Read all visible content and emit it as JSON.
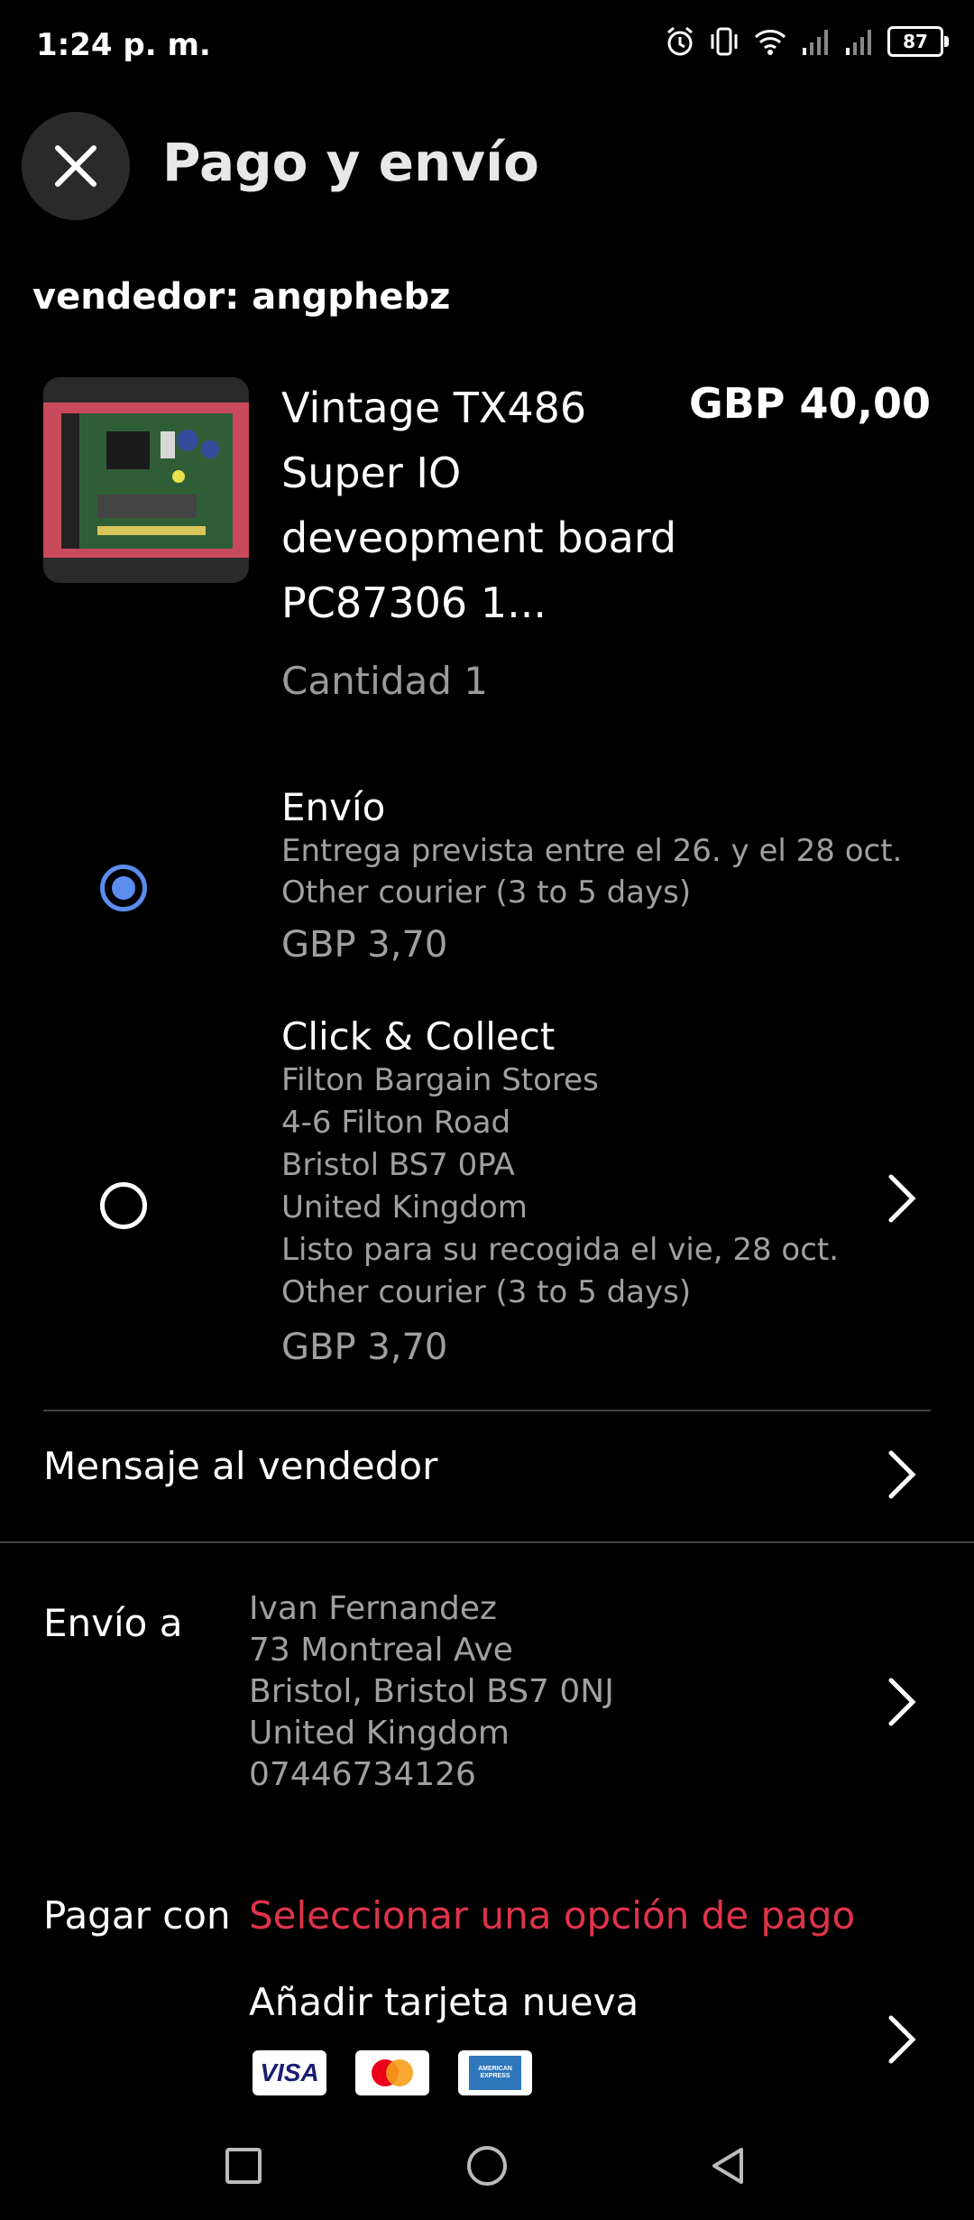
{
  "status_bar": {
    "time": "1:24 p. m.",
    "battery": "87"
  },
  "header": {
    "title": "Pago y envío"
  },
  "seller": {
    "label": "vendedor: angphebz"
  },
  "item": {
    "title": "Vintage TX486 Super IO deveopment board PC87306 1...",
    "price": "GBP 40,00",
    "quantity": "Cantidad 1"
  },
  "shipping_options": [
    {
      "title": "Envío",
      "lines": [
        "Entrega prevista entre el 26. y el 28 oct.",
        "Other courier (3 to 5 days)"
      ],
      "price": "GBP 3,70",
      "selected": true
    },
    {
      "title": "Click & Collect",
      "lines": [
        "Filton Bargain Stores",
        "4-6 Filton Road",
        "Bristol BS7 0PA",
        "United Kingdom",
        "Listo para su recogida el vie, 28 oct.",
        "Other courier (3 to 5 days)"
      ],
      "price": "GBP 3,70",
      "selected": false
    }
  ],
  "message_row": {
    "label": "Mensaje al vendedor"
  },
  "ship_to": {
    "label": "Envío a",
    "lines": [
      "Ivan Fernandez",
      "73 Montreal Ave",
      "Bristol, Bristol BS7 0NJ",
      "United Kingdom",
      "07446734126"
    ]
  },
  "payment": {
    "label": "Pagar con",
    "select_link": "Seleccionar una opción de pago",
    "add_card": "Añadir tarjeta nueva",
    "cards": [
      "VISA",
      "mastercard",
      "AMERICAN EXPRESS"
    ]
  },
  "colors": {
    "accent_blue": "#5b8def",
    "link_red": "#e0334a",
    "background": "#000000"
  }
}
